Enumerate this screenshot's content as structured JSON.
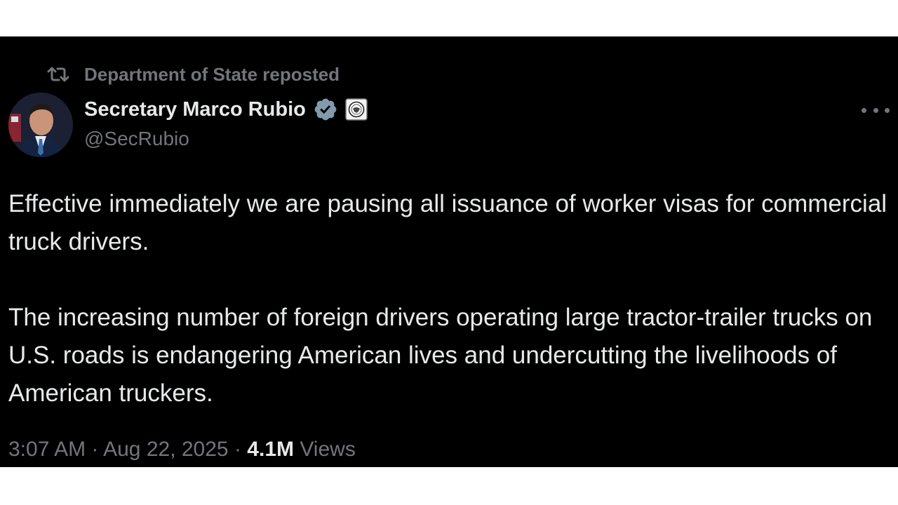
{
  "repost": {
    "text": "Department of State reposted"
  },
  "author": {
    "name": "Secretary Marco Rubio",
    "handle": "@SecRubio"
  },
  "tweet": {
    "paragraphs": [
      "Effective immediately we are pausing all issuance of worker visas for commercial truck drivers.",
      "The increasing number of foreign drivers operating large tractor-trailer trucks on U.S. roads is endangering American lives and undercutting the livelihoods of American truckers."
    ]
  },
  "meta": {
    "time": "3:07 AM",
    "separator": "·",
    "date": "Aug 22, 2025",
    "views_count": "4.1M",
    "views_label": "Views"
  },
  "icons": {
    "repost": "repost-icon",
    "verified": "verified-badge-icon",
    "affiliation": "state-department-seal-icon",
    "more": "more-options-icon"
  },
  "colors": {
    "background": "#000000",
    "text": "#e7e9ea",
    "secondary": "#71767b",
    "verified_badge": "#829aab"
  }
}
